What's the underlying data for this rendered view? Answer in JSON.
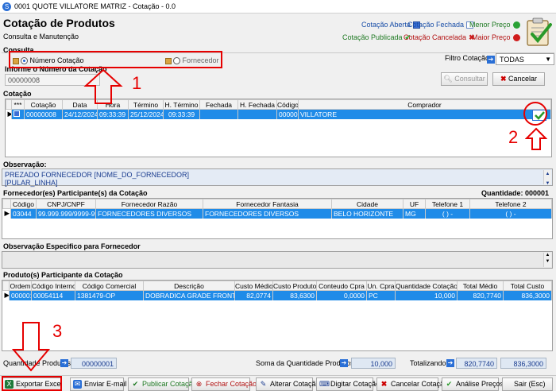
{
  "window": {
    "title": "0001 QUOTE VILLATORE MATRIZ - Cotação - 0.0"
  },
  "header": {
    "title": "Cotação de Produtos",
    "subtitle": "Consulta e Manutenção"
  },
  "legend": {
    "cotacao_aberta": "Cotação Aberta",
    "cotacao_fechada": "Cotação Fechada",
    "menor_preco": "Menor Preço",
    "cotacao_publicada": "Cotação Publicada",
    "cotacao_cancelada": "Cotação Cancelada",
    "maior_preco": "Maior Preço",
    "colors": {
      "aberta": "#3b6fd6",
      "fechada": "#ffffff",
      "publicada": "#38a532",
      "cancelada": "#d01c1c",
      "menor": "#2aa236",
      "maior": "#d01c1c"
    }
  },
  "consulta": {
    "label": "Consulta",
    "radio_numero": "Número Cotação",
    "radio_fornecedor": "Fornecedor",
    "filtro_label": "Filtro Cotação:",
    "filtro_value": "TODAS",
    "informe_label": "Informe o Número da Cotação",
    "numero_value": "00000008",
    "btn_consultar": "Consultar",
    "btn_cancelar": "Cancelar"
  },
  "cotacao": {
    "label": "Cotação",
    "columns": [
      "***",
      "Cotação",
      "Data",
      "Hora",
      "Término",
      "H. Término",
      "Fechada",
      "H. Fechada",
      "Código",
      "Comprador"
    ],
    "rows": [
      {
        "cotacao": "00000008",
        "data": "24/12/2024",
        "hora": "09:33:39",
        "termino": "25/12/2024",
        "h_termino": "09:33:39",
        "fechada": "",
        "h_fechada": "",
        "codigo": "00000",
        "comprador": "VILLATORE"
      }
    ]
  },
  "observacao": {
    "label": "Observação:",
    "lines": [
      "PREZADO FORNECEDOR [NOME_DO_FORNECEDOR]",
      "[PULAR_LINHA]"
    ]
  },
  "fornecedores": {
    "label": "Fornecedor(es) Participante(s) da Cotação",
    "quantidade_label": "Quantidade:",
    "quantidade_value": "000001",
    "columns": [
      "Código",
      "CNPJ/CNPF",
      "Fornecedor Razão",
      "Fornecedor Fantasia",
      "Cidade",
      "UF",
      "Telefone 1",
      "Telefone 2"
    ],
    "rows": [
      {
        "codigo": "03044",
        "cnpj": "99.999.999/9999-99",
        "razao": "FORNECEDORES DIVERSOS",
        "fantasia": "FORNECEDORES DIVERSOS",
        "cidade": "BELO HORIZONTE",
        "uf": "MG",
        "tel1": "(  )   -",
        "tel2": "(  )   -"
      }
    ]
  },
  "obs_fornecedor": {
    "label": "Observação Especifico para Fornecedor"
  },
  "produtos": {
    "label": "Produto(s) Participante da Cotação",
    "columns": [
      "Ordem",
      "Código Interno",
      "Código Comercial",
      "Descrição",
      "Custo Médio",
      "Custo Produto",
      "Conteudo Cpra",
      "Un. Cpra",
      "Quantidade Cotação",
      "Total Médio",
      "Total Custo"
    ],
    "rows": [
      {
        "ordem": "000001",
        "interno": "00054114",
        "comercial": "1381479-OP",
        "descricao": "DOBRADICA GRADE FRONTAL",
        "custo_medio": "82,0774",
        "custo_produto": "83,6300",
        "conteudo": "0,0000",
        "un": "PC",
        "quantidade": "10,000",
        "total_medio": "820,7740",
        "total_custo": "836,3000"
      }
    ]
  },
  "summary": {
    "qtd_produtos_label": "Quantidade Produtos:",
    "qtd_produtos_value": "00000001",
    "soma_label": "Soma da Quantidade Produtos:",
    "soma_value": "10,000",
    "totalizando_label": "Totalizando:",
    "total_medio": "820,7740",
    "total_custo": "836,3000"
  },
  "toolbar": {
    "exportar": "Exportar Excel",
    "enviar": "Enviar E-mail",
    "publicar": "Publicar Cotação",
    "fechar": "Fechar Cotação",
    "alterar": "Alterar Cotação",
    "digitar": "Digitar Cotação",
    "cancelar": "Cancelar Cotação",
    "analise": "Análise Preços",
    "sair": "Sair (Esc)"
  },
  "annotations": {
    "n1": "1",
    "n2": "2",
    "n3": "3",
    "color": "#e60000"
  }
}
